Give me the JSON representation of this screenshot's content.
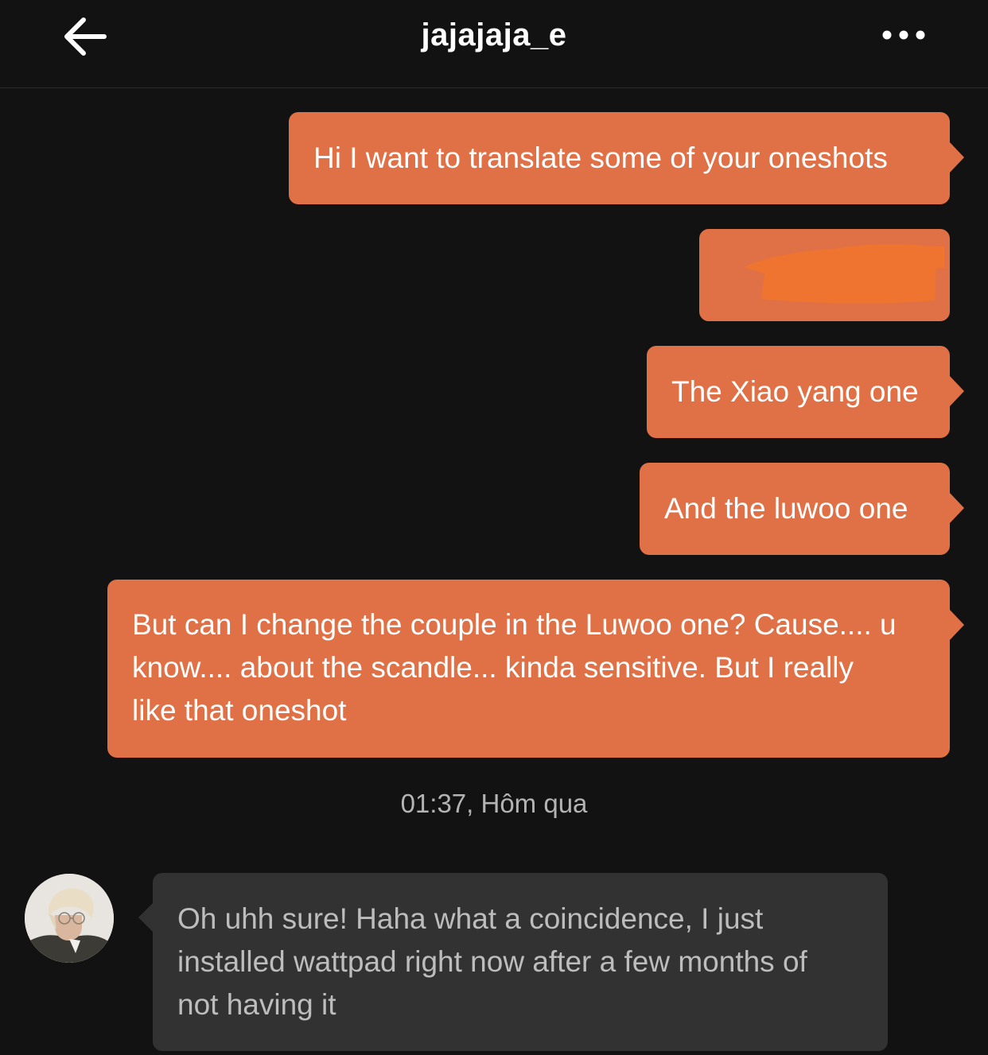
{
  "header": {
    "title": "jajajaja_e",
    "back_icon": "arrow-left-icon",
    "more_icon": "more-horizontal-icon"
  },
  "messages": [
    {
      "direction": "sent",
      "text": "Hi I want to translate some of your oneshots"
    },
    {
      "direction": "sent",
      "text": "",
      "redacted": true
    },
    {
      "direction": "sent",
      "text": "The Xiao yang one"
    },
    {
      "direction": "sent",
      "text": "And the luwoo one"
    },
    {
      "direction": "sent",
      "text": "But can I change the couple in the Luwoo one? Cause.... u\nknow.... about the scandle... kinda sensitive. But I really\nlike that oneshot"
    },
    {
      "direction": "received",
      "text": "Oh uhh sure! Haha what a coincidence, I just\ninstalled wattpad right now after a few months of\nnot having it"
    }
  ],
  "timestamp": "01:37, Hôm qua",
  "colors": {
    "background": "#121212",
    "sent_bubble": "#e07046",
    "received_bubble": "#323232",
    "received_text": "#bdbdbd",
    "timestamp_text": "#b4b4b4",
    "redaction_mark": "#ee7430"
  }
}
